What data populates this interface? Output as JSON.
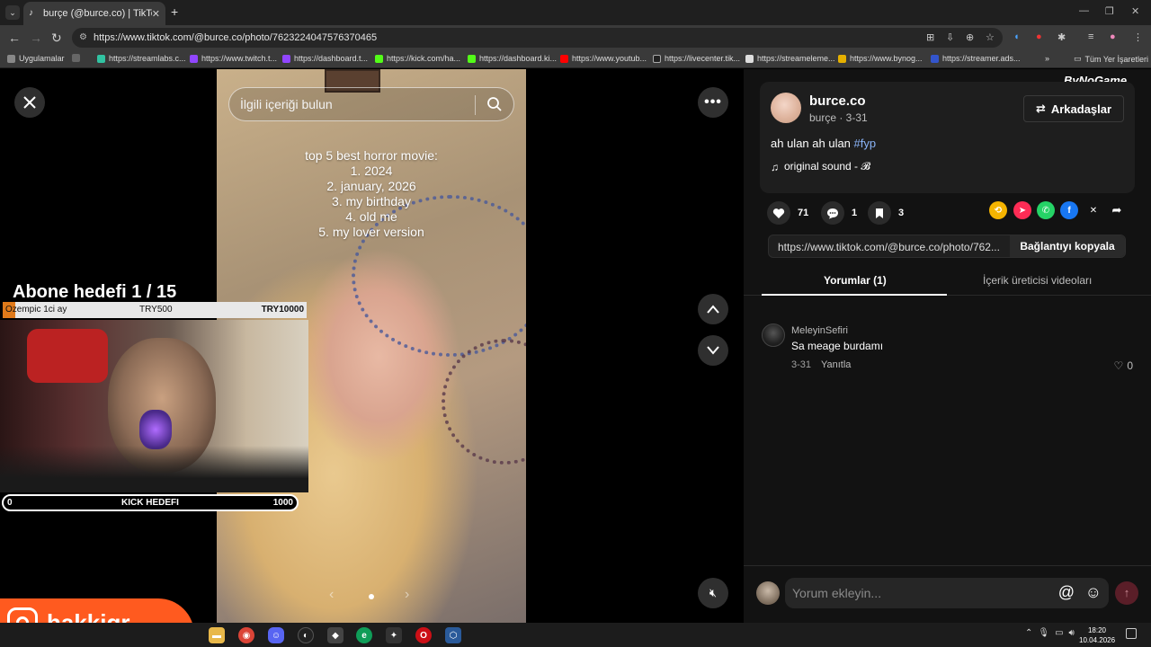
{
  "browser": {
    "tab_title": "burçe (@burce.co) | TikTok",
    "url": "https://www.tiktok.com/@burce.co/photo/7623224047576370465",
    "bookmarks": [
      "Uygulamalar",
      "https://streamlabs.c...",
      "https://www.twitch.t...",
      "https://dashboard.t...",
      "https://kick.com/ha...",
      "https://dashboard.ki...",
      "https://www.youtub...",
      "https://livecenter.tik...",
      "https://streameleme...",
      "https://www.bynog...",
      "https://streamer.ads..."
    ],
    "all_bookmarks": "Tüm Yer İşaretleri",
    "more_bookmarks": "»"
  },
  "viewer": {
    "search_placeholder": "İlgili içeriği bulun",
    "caption_lines": [
      "top 5 best horror movie:",
      "1. 2024",
      "2. january, 2026",
      "3. my birthday",
      "4. old me",
      "5. my lover version"
    ]
  },
  "overlay": {
    "goal_title": "Abone hedefi 1 / 15",
    "goal_progress": 0.04,
    "goal_left": "Ozempic 1ci ay",
    "goal_mid": "TRY500",
    "goal_right": "TRY10000",
    "kick_min": "0",
    "kick_label": "KICK HEDEFI",
    "kick_max": "1000",
    "channel_name": "hakkigr"
  },
  "post": {
    "brand_watermark": "ByNoGame",
    "username": "burce.co",
    "nickname_date": "burçe · 3-31",
    "friends_button": "Arkadaşlar",
    "description_text": "ah ulan ah ulan ",
    "hashtag": "#fyp",
    "sound": "original sound - 𝓑",
    "likes": "71",
    "comments": "1",
    "saves": "3",
    "link": "https://www.tiktok.com/@burce.co/photo/762...",
    "copy_link": "Bağlantıyı kopyala",
    "tab_comments": "Yorumlar (1)",
    "tab_creator_videos": "İçerik üreticisi videoları"
  },
  "comments": [
    {
      "user": "MeleyinSefiri",
      "text": "Sa meage burdamı",
      "date": "3-31",
      "reply": "Yanıtla",
      "likes": "0"
    }
  ],
  "composer": {
    "placeholder": "Yorum ekleyin...",
    "at": "@"
  },
  "taskbar": {
    "time": "18:20",
    "date": "10.04.2026"
  },
  "colors": {
    "tiktok_accent": "#fe2c55",
    "goal_fill": "#e07a1a",
    "hakkigr_orange": "#ff5a1f",
    "hashtag_blue": "#8ab4f8"
  }
}
